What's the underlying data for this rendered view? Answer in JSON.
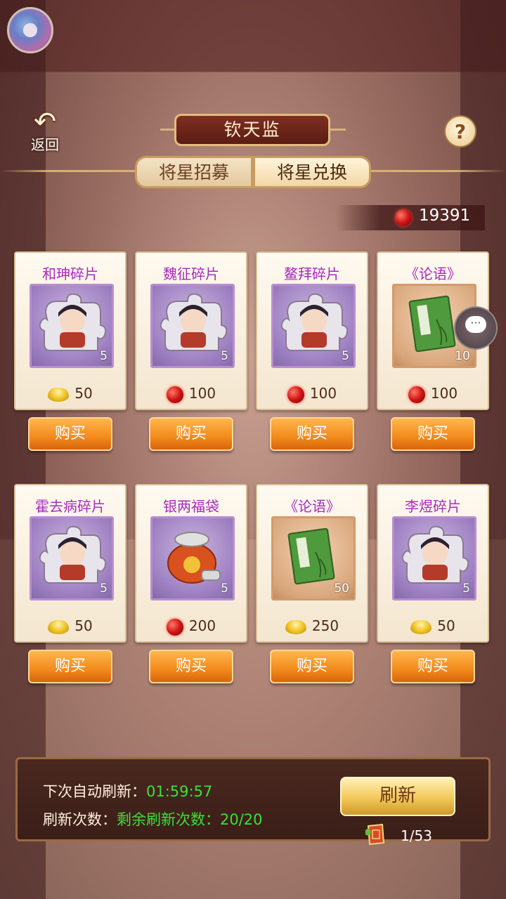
{
  "header": {
    "back_label": "返回",
    "title": "钦天监",
    "help_symbol": "?",
    "tabs": [
      {
        "label": "将星招募",
        "active": false
      },
      {
        "label": "将星兑换",
        "active": true
      }
    ]
  },
  "wallet": {
    "icon": "red-gem-icon",
    "amount": "19391"
  },
  "shop": {
    "buy_label": "购买",
    "items": [
      {
        "name": "和珅碎片",
        "kind": "hero-fragment",
        "qty": "5",
        "price_icon": "gold-ingot-icon",
        "price": "50"
      },
      {
        "name": "魏征碎片",
        "kind": "hero-fragment",
        "qty": "5",
        "price_icon": "red-gem-icon",
        "price": "100"
      },
      {
        "name": "鳌拜碎片",
        "kind": "hero-fragment",
        "qty": "5",
        "price_icon": "red-gem-icon",
        "price": "100"
      },
      {
        "name": "《论语》",
        "kind": "book",
        "qty": "10",
        "price_icon": "red-gem-icon",
        "price": "100"
      },
      {
        "name": "霍去病碎片",
        "kind": "hero-fragment",
        "qty": "5",
        "price_icon": "gold-ingot-icon",
        "price": "50"
      },
      {
        "name": "银两福袋",
        "kind": "silver-bag",
        "qty": "5",
        "price_icon": "red-gem-icon",
        "price": "200"
      },
      {
        "name": "《论语》",
        "kind": "book",
        "qty": "50",
        "price_icon": "gold-ingot-icon",
        "price": "250"
      },
      {
        "name": "李煜碎片",
        "kind": "hero-fragment",
        "qty": "5",
        "price_icon": "gold-ingot-icon",
        "price": "50"
      }
    ]
  },
  "refresh_panel": {
    "next_label": "下次自动刷新：",
    "next_time": "01:59:57",
    "count_label": "刷新次数：",
    "count_value": "剩余刷新次数：20/20",
    "button_label": "刷新",
    "ticket_count": "1/53"
  },
  "colors": {
    "accent_purple": "#a82ac0",
    "buy_orange": "#f28a1c",
    "timer_green": "#39e13a"
  }
}
